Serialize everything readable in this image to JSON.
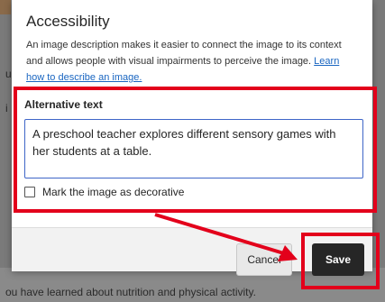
{
  "background": {
    "text_fragment_1": "u",
    "text_fragment_2": "i",
    "bottom_line": "ou have learned about nutrition and physical activity."
  },
  "modal": {
    "title": "Accessibility",
    "description_text": "An image description makes it easier to connect the image to its context and allows people with visual impairments to perceive the image. ",
    "learn_link": "Learn how to describe an image.",
    "alt_text_label": "Alternative text",
    "alt_text_value": "A preschool teacher explores different sensory games with her students at a table.",
    "decorative_label": "Mark the image as decorative",
    "decorative_checked": false,
    "cancel_label": "Cancel",
    "save_label": "Save"
  },
  "colors": {
    "highlight": "#e3001b",
    "field_border": "#3f66c8",
    "save_bg": "#262626",
    "link": "#1a66c1"
  }
}
